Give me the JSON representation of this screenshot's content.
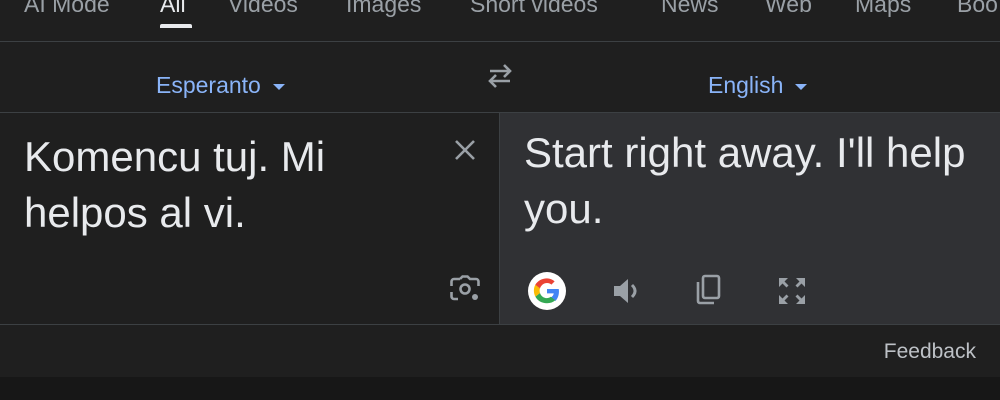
{
  "tabs": [
    {
      "label": "AI Mode",
      "active": false
    },
    {
      "label": "All",
      "active": true
    },
    {
      "label": "Videos",
      "active": false
    },
    {
      "label": "Images",
      "active": false
    },
    {
      "label": "Short videos",
      "active": false
    },
    {
      "label": "News",
      "active": false
    },
    {
      "label": "Web",
      "active": false
    },
    {
      "label": "Maps",
      "active": false
    },
    {
      "label": "Boo",
      "active": false
    }
  ],
  "translate": {
    "source_language": "Esperanto",
    "target_language": "English",
    "source_text": "Komencu tuj. Mi helpos al vi.",
    "translated_text": "Start right away. I'll help you."
  },
  "icons": {
    "swap": "swap-languages-icon",
    "clear": "close-icon",
    "lens": "camera-lens-icon",
    "google": "google-logo-icon",
    "speak": "speaker-icon",
    "copy": "copy-icon",
    "expand": "fullscreen-icon"
  },
  "footer": {
    "feedback_label": "Feedback"
  },
  "colors": {
    "background": "#1f1f1f",
    "output_panel": "#303134",
    "accent": "#8ab4f8",
    "text": "#e8eaed",
    "muted": "#9aa0a6"
  }
}
